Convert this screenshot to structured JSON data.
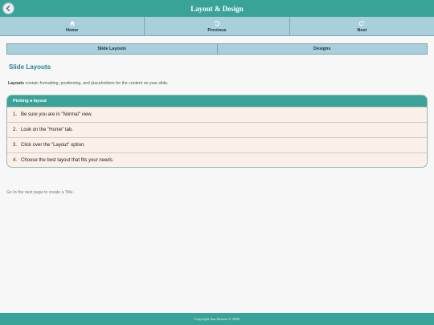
{
  "header": {
    "title": "Layout & Design",
    "back_icon": "back-arrow-icon"
  },
  "nav": {
    "home": {
      "label": "Home",
      "icon": "home-icon"
    },
    "previous": {
      "label": "Previous",
      "icon": "undo-icon"
    },
    "next": {
      "label": "Next",
      "icon": "redo-icon"
    }
  },
  "tabs": {
    "slide_layouts": "Slide Layouts",
    "designs": "Designs"
  },
  "content": {
    "section_title": "Slide Layouts",
    "intro_bold": "Layouts",
    "intro_rest": " contain formatting, positioning, and placeholders for the content on your slide.",
    "panel_title": "Picking a layout",
    "steps": [
      {
        "num": "1.",
        "text": "Be sure you are in \"Normal\" view."
      },
      {
        "num": "2.",
        "text": "Look on the \"Home\" tab."
      },
      {
        "num": "3.",
        "text": "Click over the \"Layout\" option."
      },
      {
        "num": "4.",
        "text": "Choose the best layout that fits your needs."
      }
    ],
    "next_note": "Go to the next page to create a Title."
  },
  "footer": {
    "copyright": "Copyright Ana Herrera © 2009"
  },
  "colors": {
    "accent": "#3aa399",
    "nav_bg": "#a9cfdc",
    "section_title": "#2a7f99",
    "panel_bg": "#faf0e9"
  }
}
